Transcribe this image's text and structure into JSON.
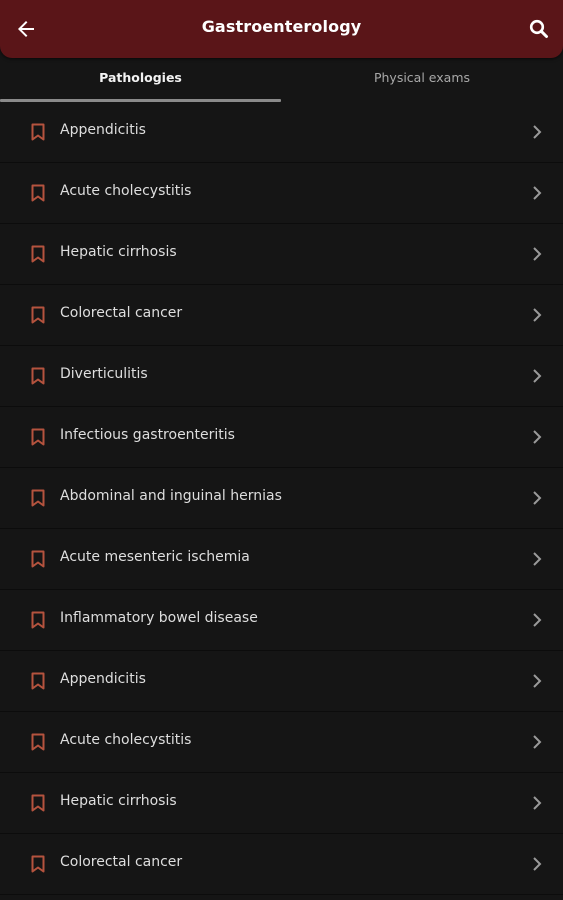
{
  "header": {
    "title": "Gastroenterology"
  },
  "tabs": [
    {
      "label": "Pathologies",
      "active": true
    },
    {
      "label": "Physical exams",
      "active": false
    }
  ],
  "colors": {
    "appbar": "#5a1518",
    "background": "#151515",
    "bookmark": "#b5533e"
  },
  "icons": {
    "back": "arrow-left-icon",
    "search": "search-icon",
    "item_leading": "bookmark-icon",
    "item_trailing": "chevron-right-icon"
  },
  "items": [
    {
      "label": "Appendicitis"
    },
    {
      "label": "Acute cholecystitis"
    },
    {
      "label": "Hepatic cirrhosis"
    },
    {
      "label": "Colorectal cancer"
    },
    {
      "label": "Diverticulitis"
    },
    {
      "label": "Infectious gastroenteritis"
    },
    {
      "label": "Abdominal and inguinal hernias"
    },
    {
      "label": "Acute mesenteric ischemia"
    },
    {
      "label": "Inflammatory bowel disease"
    },
    {
      "label": "Appendicitis"
    },
    {
      "label": "Acute cholecystitis"
    },
    {
      "label": "Hepatic cirrhosis"
    },
    {
      "label": "Colorectal cancer"
    }
  ]
}
